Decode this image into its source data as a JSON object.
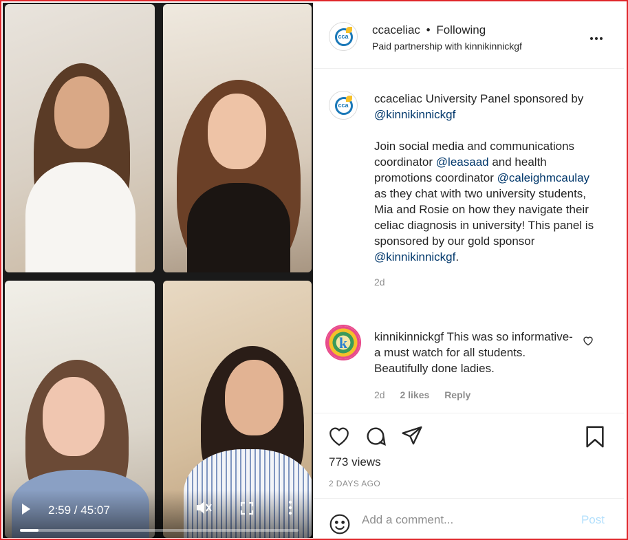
{
  "video": {
    "timecode": "2:59 / 45:07",
    "progress": 0.066
  },
  "header": {
    "username": "ccaceliac",
    "separator": "•",
    "follow_state": "Following",
    "partnership_prefix": "Paid partnership with",
    "partner": "kinnikinnickgf",
    "avatar_text": "cca acmc"
  },
  "caption": {
    "username": "ccaceliac",
    "line1": "University Panel sponsored by",
    "mention_sponsor": "@kinnikinnickgf",
    "p2_a": "Join social media and communications coordinator",
    "mention_1": "@leasaad",
    "p2_b": "and health promotions coordinator",
    "mention_2": "@caleighmcaulay",
    "p2_c": "as they chat with two university students, Mia and Rosie on how they navigate their celiac diagnosis in university! This panel is sponsored by our gold sponsor",
    "mention_3": "@kinnikinnickgf",
    "p2_end": ".",
    "time": "2d"
  },
  "comment": {
    "username": "kinnikinnickgf",
    "text": "This was so informative- a must watch for all students. Beautifully done ladies.",
    "time": "2d",
    "likes": "2 likes",
    "reply": "Reply",
    "avatar_letter": "k"
  },
  "stats": {
    "views": "773 views",
    "date": "2 DAYS AGO"
  },
  "comment_box": {
    "placeholder": "Add a comment...",
    "post_label": "Post"
  },
  "colors": {
    "accent_link": "#00376b",
    "post_disabled": "#b2dffc",
    "frame_border": "#e0262a"
  },
  "icons": [
    "play-icon",
    "mute-icon",
    "fullscreen-icon",
    "more-vertical-icon",
    "more-horizontal-icon",
    "heart-icon",
    "comment-icon",
    "share-icon",
    "bookmark-icon",
    "emoji-icon"
  ]
}
